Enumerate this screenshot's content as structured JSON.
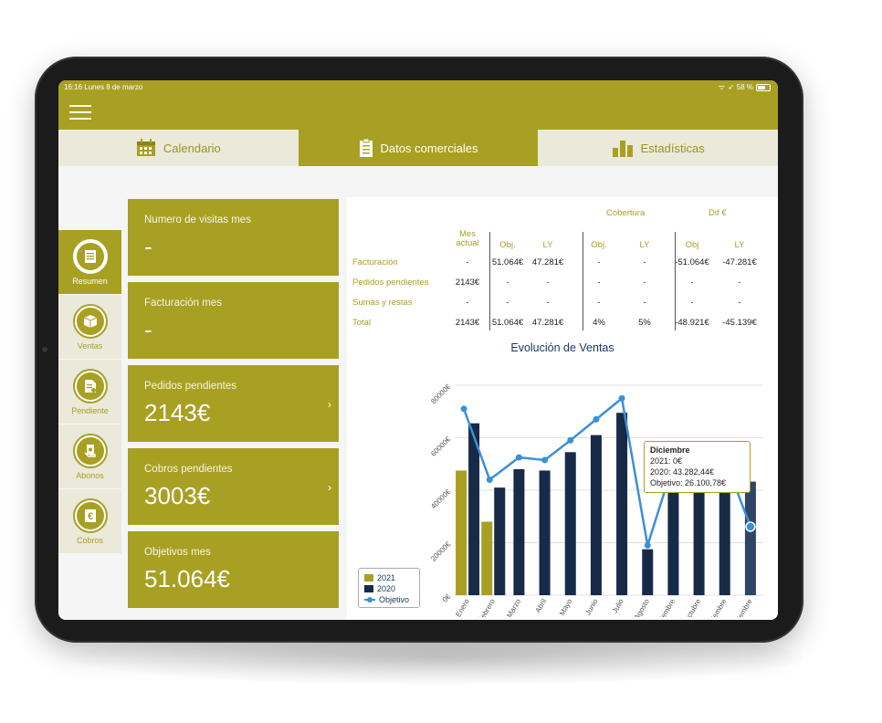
{
  "status_bar": {
    "time": "16:16  Lunes 8 de marzo",
    "battery": "58 %"
  },
  "tabs": [
    {
      "label": "Calendario",
      "icon": "calendar-icon"
    },
    {
      "label": "Datos comerciales",
      "icon": "clipboard-icon",
      "active": true
    },
    {
      "label": "Estadísticas",
      "icon": "bar-chart-icon"
    }
  ],
  "sidenav": [
    {
      "label": "Resumen",
      "icon": "document-icon",
      "active": true
    },
    {
      "label": "Ventas",
      "icon": "box-icon"
    },
    {
      "label": "Pendiente",
      "icon": "pending-doc-icon"
    },
    {
      "label": "Abonos",
      "icon": "money-hand-icon"
    },
    {
      "label": "Cobros",
      "icon": "euro-icon"
    }
  ],
  "cards": [
    {
      "title": "Numero de visitas mes",
      "value": "-"
    },
    {
      "title": "Facturación mes",
      "value": "-"
    },
    {
      "title": "Pedidos pendientes",
      "value": "2143€",
      "arrow": "›"
    },
    {
      "title": "Cobros pendientes",
      "value": "3003€",
      "arrow": "›"
    },
    {
      "title": "Objetivos mes",
      "value": "51.064€"
    }
  ],
  "table": {
    "group_headers": [
      "Cobertura",
      "Dif €"
    ],
    "headers": [
      "Mes actual",
      "Obj.",
      "LY",
      "Obj.",
      "LY",
      "Obj",
      "LY"
    ],
    "rows": [
      {
        "label": "Facturación",
        "cells": [
          "-",
          "51.064€",
          "47.281€",
          "-",
          "-",
          "-51.064€",
          "-47.281€"
        ]
      },
      {
        "label": "Pedidos pendientes",
        "cells": [
          "2143€",
          "-",
          "-",
          "-",
          "-",
          "-",
          "-"
        ]
      },
      {
        "label": "Sumas y restas",
        "cells": [
          "-",
          "-",
          "-",
          "-",
          "-",
          "-",
          "-"
        ]
      },
      {
        "label": "Total",
        "cells": [
          "2143€",
          "51.064€",
          "47.281€",
          "4%",
          "5%",
          "-48.921€",
          "-45.139€"
        ]
      }
    ]
  },
  "tooltip": {
    "title": "Diciembre",
    "line1": "2021: 0€",
    "line2": "2020: 43.282,44€",
    "line3": "Objetivo: 26.100,78€"
  },
  "colors": {
    "accent": "#a8a022",
    "navy": "#172a48",
    "line": "#3b8fd9"
  },
  "chart_data": {
    "type": "bar",
    "title": "Evolución de Ventas",
    "categories": [
      "Enero",
      "Febrero",
      "Marzo",
      "Abril",
      "Mayo",
      "Junio",
      "Julio",
      "Agosto",
      "Septiembre",
      "Octubre",
      "Noviembre",
      "Diciembre"
    ],
    "yticks": [
      "0€",
      "20000€",
      "40000€",
      "60000€",
      "80000€"
    ],
    "ylim": [
      0,
      80000
    ],
    "series": [
      {
        "name": "2021",
        "kind": "bar",
        "values": [
          47500,
          28000,
          0,
          0,
          0,
          0,
          0,
          0,
          0,
          0,
          0,
          0
        ]
      },
      {
        "name": "2020",
        "kind": "bar",
        "values": [
          65500,
          41000,
          48000,
          47500,
          54500,
          61000,
          69500,
          17500,
          48500,
          51000,
          47500,
          43282.44
        ]
      },
      {
        "name": "Objetivo",
        "kind": "line",
        "values": [
          71000,
          44000,
          52500,
          51500,
          59000,
          67000,
          75000,
          19000,
          50000,
          56000,
          52000,
          26100.78
        ]
      }
    ],
    "legend": "bottom-left",
    "grid": true
  }
}
